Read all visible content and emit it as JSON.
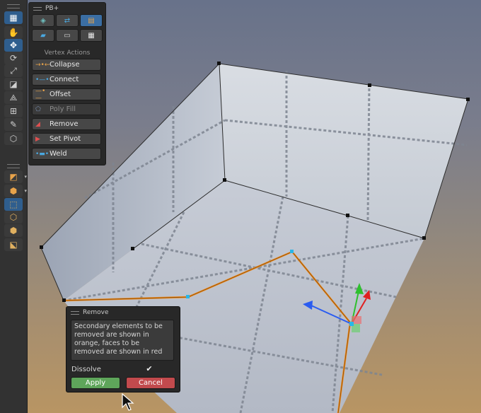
{
  "toolbar": {
    "tools": [
      {
        "name": "grid-snap-icon",
        "glyph": "▦"
      },
      {
        "name": "hand-tool-icon",
        "glyph": "✋"
      },
      {
        "name": "move-tool-icon",
        "glyph": "✥"
      },
      {
        "name": "rotate-tool-icon",
        "glyph": "⟳"
      },
      {
        "name": "scale-tool-icon",
        "glyph": "⤢"
      },
      {
        "name": "rect-tool-icon",
        "glyph": "◪"
      },
      {
        "name": "transform-tool-icon",
        "glyph": "⟁"
      },
      {
        "name": "custom-tool-icon",
        "glyph": "⊞"
      },
      {
        "name": "pen-tool-icon",
        "glyph": "✎"
      },
      {
        "name": "shape-tool-icon",
        "glyph": "⬡"
      }
    ],
    "modes": [
      {
        "name": "edit-mode-icon",
        "glyph": "◩"
      },
      {
        "name": "object-mode-icon",
        "glyph": "⬢"
      },
      {
        "name": "vertex-mode-icon",
        "glyph": "⬚"
      },
      {
        "name": "edge-mode-icon",
        "glyph": "⬡"
      },
      {
        "name": "face-mode-icon",
        "glyph": "⬢"
      },
      {
        "name": "pivot-mode-icon",
        "glyph": "⬕"
      }
    ]
  },
  "pb_panel": {
    "title": "PB+",
    "section_label": "Vertex Actions",
    "icon_buttons": [
      {
        "name": "new-shape-icon",
        "glyph": "◈"
      },
      {
        "name": "uv-editor-icon",
        "glyph": "⇄"
      },
      {
        "name": "material-icon",
        "glyph": "▤"
      },
      {
        "name": "open-folder-icon",
        "glyph": "▰"
      },
      {
        "name": "smoothing-icon",
        "glyph": "▭"
      },
      {
        "name": "checker-icon",
        "glyph": "▦"
      }
    ],
    "actions": [
      {
        "label": "Collapse",
        "icon": "collapse-icon",
        "glyph": "→•←",
        "color": "#e8a34a",
        "enabled": true
      },
      {
        "label": "Connect",
        "icon": "connect-icon",
        "glyph": "•—•",
        "color": "#4aa8e0",
        "enabled": true
      },
      {
        "label": "Offset",
        "icon": "offset-icon",
        "glyph": "—•—",
        "color": "#e8a34a",
        "enabled": true
      },
      {
        "label": "Poly Fill",
        "icon": "poly-fill-icon",
        "glyph": "⬠",
        "color": "#7a8fb0",
        "enabled": false
      },
      {
        "label": "Remove",
        "icon": "remove-icon",
        "glyph": "◢",
        "color": "#e05050",
        "enabled": true
      },
      {
        "label": "Set Pivot",
        "icon": "set-pivot-icon",
        "glyph": "▶",
        "color": "#e05050",
        "enabled": true
      },
      {
        "label": "Weld",
        "icon": "weld-icon",
        "glyph": "•▬•",
        "color": "#4aa8e0",
        "enabled": true
      }
    ]
  },
  "remove_panel": {
    "title": "Remove",
    "info": "Secondary elements to be removed are shown in orange, faces to be removed are shown in red",
    "dissolve_label": "Dissolve",
    "dissolve_checked": true,
    "apply_label": "Apply",
    "cancel_label": "Cancel"
  },
  "colors": {
    "accent": "#2f5e8e",
    "apply": "#5ea55a",
    "cancel": "#c24a4d",
    "selection_orange": "#f08c1e",
    "vertex_cyan": "#29b6e8",
    "gizmo_x": "#e02020",
    "gizmo_y": "#2ec02e",
    "gizmo_z": "#2a5cf0"
  }
}
